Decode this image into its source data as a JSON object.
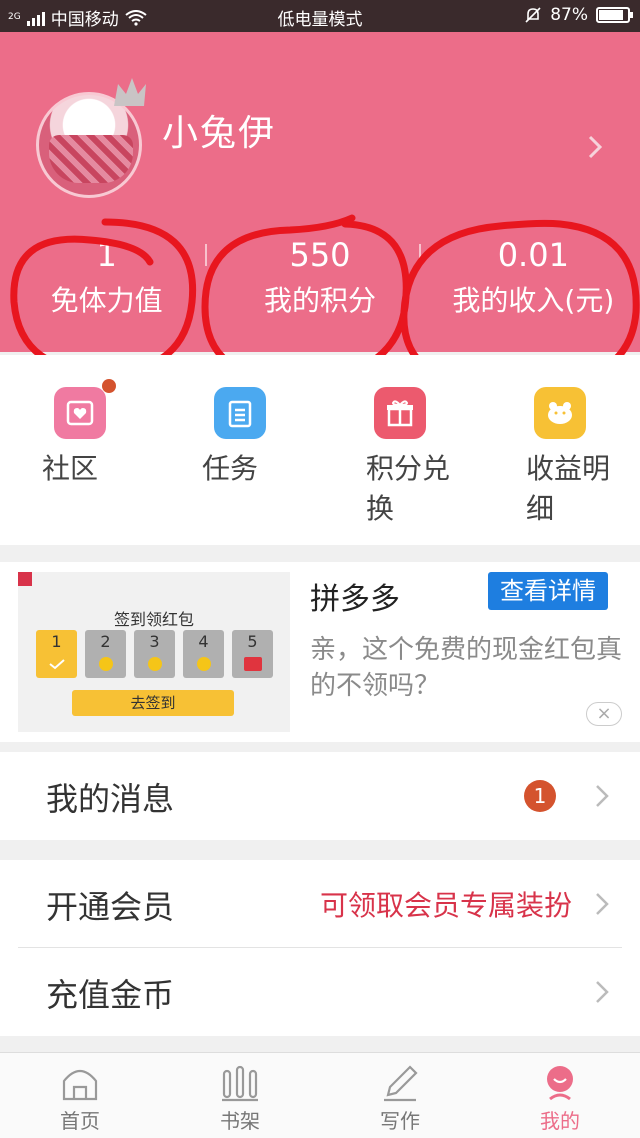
{
  "status_bar": {
    "network_type": "2G",
    "carrier": "中国移动",
    "mode": "低电量模式",
    "battery": "87%",
    "battery_level": 0.87
  },
  "profile": {
    "username": "小兔伊",
    "stats": [
      {
        "value": "1",
        "label": "免体力值"
      },
      {
        "value": "550",
        "label": "我的积分"
      },
      {
        "value": "0.01",
        "label": "我的收入(元)"
      }
    ]
  },
  "quick_actions": [
    {
      "label": "社区",
      "icon": "community-icon",
      "color": "#f07aa1",
      "has_dot": true
    },
    {
      "label": "任务",
      "icon": "task-icon",
      "color": "#4ba9f0",
      "has_dot": false
    },
    {
      "label": "积分兑换",
      "icon": "gift-icon",
      "color": "#ec5a6e",
      "has_dot": false
    },
    {
      "label": "收益明细",
      "icon": "piggy-icon",
      "color": "#f7c135",
      "has_dot": false
    }
  ],
  "ad": {
    "image_title": "签到领红包",
    "days": [
      "1",
      "2",
      "3",
      "4",
      "5"
    ],
    "go_button": "去签到",
    "title": "拼多多",
    "button": "查看详情",
    "description": "亲，这个免费的现金红包真的不领吗？",
    "close": "×"
  },
  "menu": {
    "messages": {
      "label": "我的消息",
      "badge": "1"
    },
    "vip": {
      "label": "开通会员",
      "hint": "可领取会员专属装扮"
    },
    "recharge": {
      "label": "充值金币"
    }
  },
  "tabs": [
    {
      "label": "首页",
      "icon": "home-icon"
    },
    {
      "label": "书架",
      "icon": "bookshelf-icon"
    },
    {
      "label": "写作",
      "icon": "pencil-icon"
    },
    {
      "label": "我的",
      "icon": "profile-icon"
    }
  ],
  "colors": {
    "brand_pink": "#ec6d89",
    "annotation_red": "#e8161f",
    "accent_blue": "#1e7ee0"
  }
}
